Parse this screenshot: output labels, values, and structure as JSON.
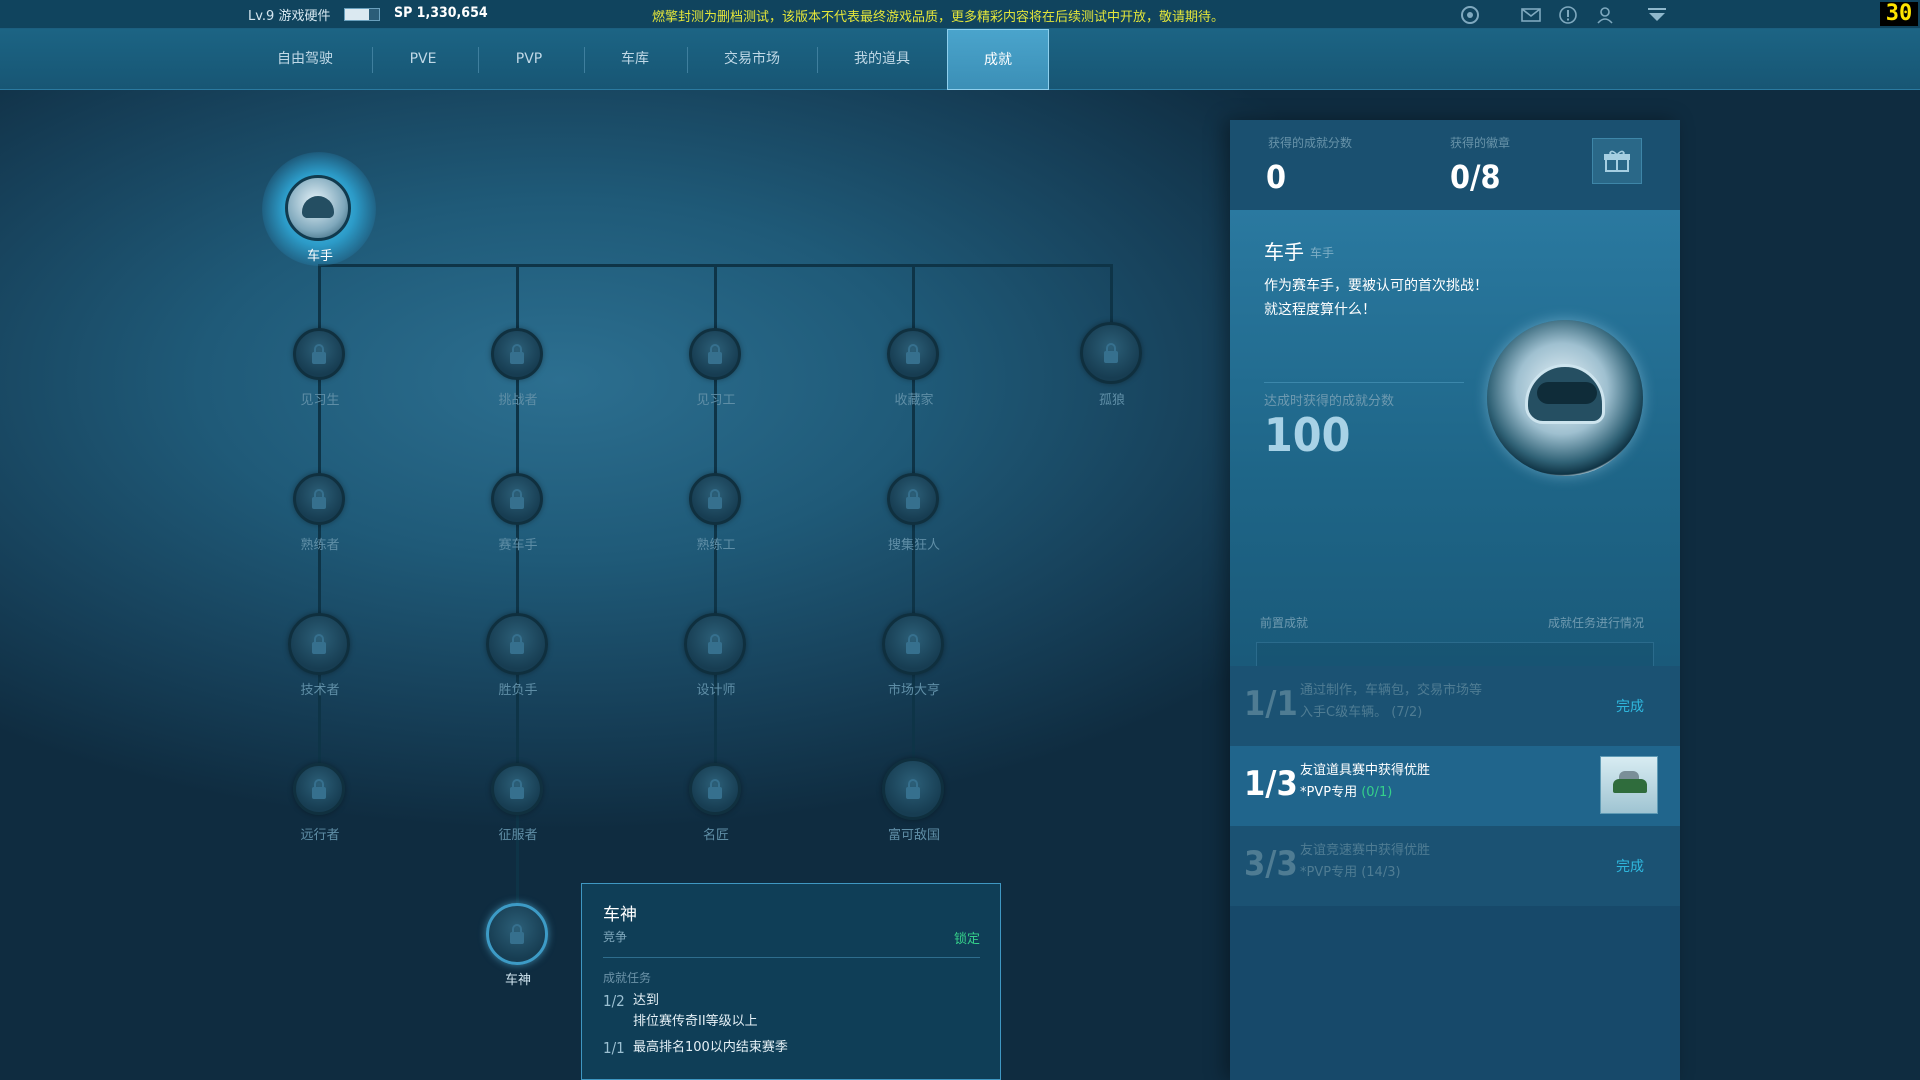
{
  "topbar": {
    "level": "Lv.9 游戏硬件",
    "level_progress": 0.7,
    "sp": "SP 1,330,654",
    "notice": "燃擎封测为删档测试，该版本不代表最终游戏品质，更多精彩内容将在后续测试中开放，敬请期待。",
    "fps": "30",
    "icons": [
      "network-icon",
      "mail-icon",
      "alert-icon",
      "user-icon",
      "dropdown-icon"
    ]
  },
  "nav": {
    "tabs": [
      {
        "label": "自由驾驶"
      },
      {
        "label": "PVE"
      },
      {
        "label": "PVP"
      },
      {
        "label": "车库"
      },
      {
        "label": "交易市场"
      },
      {
        "label": "我的道具"
      },
      {
        "label": "成就",
        "active": true
      }
    ]
  },
  "tree": {
    "root": "车手",
    "columns": [
      [
        "见习生",
        "熟练者",
        "技术者",
        "远行者"
      ],
      [
        "挑战者",
        "赛车手",
        "胜负手",
        "征服者",
        "车神"
      ],
      [
        "见习工",
        "熟练工",
        "设计师",
        "名匠"
      ],
      [
        "收藏家",
        "搜集狂人",
        "市场大亨",
        "富可敌国"
      ],
      [
        "孤狼"
      ]
    ]
  },
  "tooltip": {
    "title": "车神",
    "category": "竞争",
    "status": "锁定",
    "section": "成就任务",
    "tasks": [
      {
        "progress": "1/2",
        "line1": "达到",
        "line2": "排位赛传奇II等级以上"
      },
      {
        "progress": "1/1",
        "line1": "最高排名100以内结束赛季",
        "line2": ""
      }
    ]
  },
  "panel": {
    "score_label": "获得的成就分数",
    "score_value": "0",
    "badge_label": "获得的徽章",
    "badge_value": "0/8",
    "title": "车手",
    "subtitle": "车手",
    "desc1": "作为赛车手，要被认可的首次挑战！",
    "desc2": "就这程度算什么！",
    "reward_label": "达成时获得的成就分数",
    "reward_value": "100",
    "prereq_label": "前置成就",
    "progress_label": "成就任务进行情况",
    "tasks": [
      {
        "progress": "1/1",
        "line1": "通过制作，车辆包，交易市场等",
        "line2": "入手C级车辆。",
        "count": "(7/2)",
        "status": "完成"
      },
      {
        "progress": "1/3",
        "line1": "友谊道具赛中获得优胜",
        "line2": "*PVP专用",
        "count": "(0/1)",
        "status": ""
      },
      {
        "progress": "3/3",
        "line1": "友谊竞速赛中获得优胜",
        "line2": "*PVP专用",
        "count": "(14/3)",
        "status": "完成"
      }
    ]
  },
  "colors": {
    "accent": "#2fb7de",
    "green": "#35d08a",
    "notice": "#e3e53a"
  }
}
